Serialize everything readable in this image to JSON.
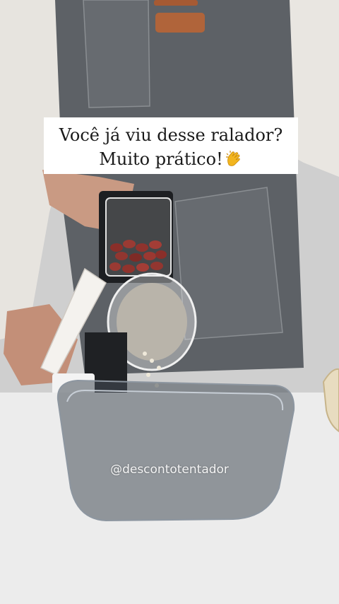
{
  "caption": {
    "line1": "Você já viu desse ralador?",
    "line2": "Muito prático!",
    "emoji": "clapping-hands-icon"
  },
  "watermark": "@descontotentador",
  "colors": {
    "caption_bg": "#ffffff",
    "caption_text": "#1a1a1a",
    "apron": "#5d6166",
    "table": "#ececec"
  }
}
